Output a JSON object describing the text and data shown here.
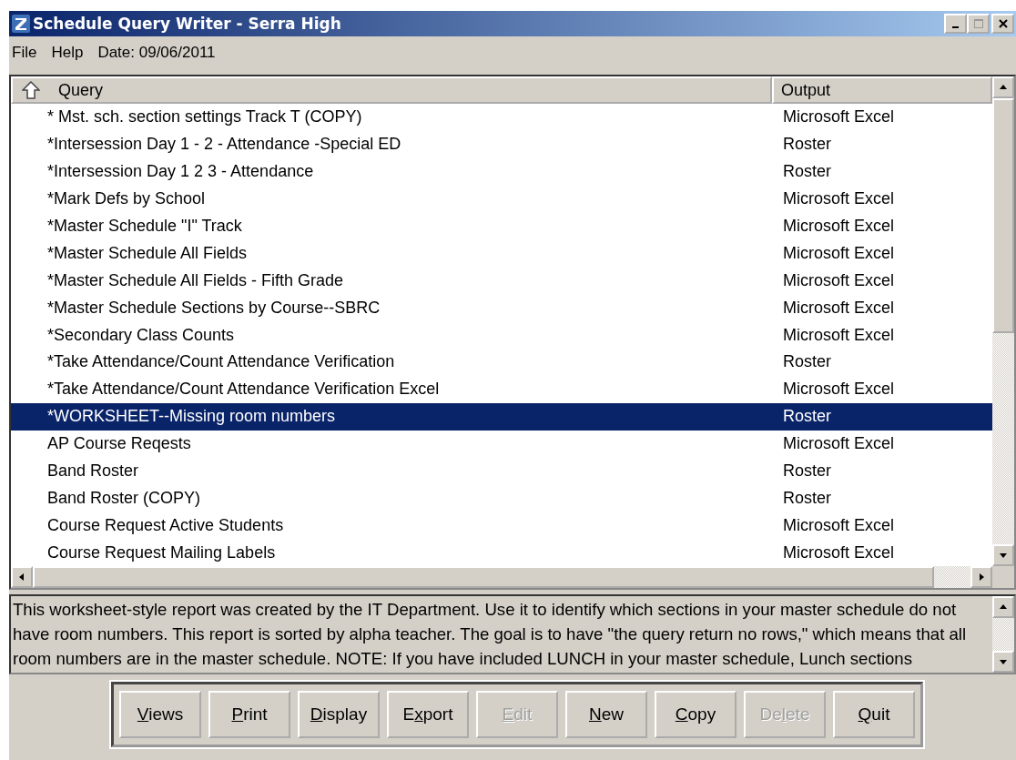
{
  "window": {
    "title": "Schedule Query Writer - Serra High"
  },
  "menu": [
    "File",
    "Help",
    "Date: 09/06/2011"
  ],
  "table": {
    "columns": [
      "Query",
      "Output"
    ],
    "rows": [
      {
        "query": "* Mst. sch. section settings Track T (COPY)",
        "output": "Microsoft Excel",
        "selected": false
      },
      {
        "query": "*Intersession Day 1 - 2 - Attendance -Special ED",
        "output": "Roster",
        "selected": false
      },
      {
        "query": "*Intersession Day 1 2 3 - Attendance",
        "output": "Roster",
        "selected": false
      },
      {
        "query": "*Mark Defs by School",
        "output": "Microsoft Excel",
        "selected": false
      },
      {
        "query": "*Master Schedule \"I\" Track",
        "output": "Microsoft Excel",
        "selected": false
      },
      {
        "query": "*Master Schedule All Fields",
        "output": "Microsoft Excel",
        "selected": false
      },
      {
        "query": "*Master Schedule All Fields - Fifth Grade",
        "output": "Microsoft Excel",
        "selected": false
      },
      {
        "query": "*Master Schedule Sections by Course--SBRC",
        "output": "Microsoft Excel",
        "selected": false
      },
      {
        "query": "*Secondary Class Counts",
        "output": "Microsoft Excel",
        "selected": false
      },
      {
        "query": "*Take Attendance/Count Attendance Verification",
        "output": "Roster",
        "selected": false
      },
      {
        "query": "*Take Attendance/Count Attendance Verification Excel",
        "output": "Microsoft Excel",
        "selected": false
      },
      {
        "query": "*WORKSHEET--Missing room numbers",
        "output": "Roster",
        "selected": true
      },
      {
        "query": "AP Course Reqests",
        "output": "Microsoft Excel",
        "selected": false
      },
      {
        "query": "Band Roster",
        "output": "Roster",
        "selected": false
      },
      {
        "query": "Band Roster (COPY)",
        "output": "Roster",
        "selected": false
      },
      {
        "query": "Course Request Active Students",
        "output": "Microsoft Excel",
        "selected": false
      },
      {
        "query": "Course Request Mailing Labels",
        "output": "Microsoft Excel",
        "selected": false
      }
    ]
  },
  "description": "This worksheet-style report was created by the IT Department. Use it to identify which sections in your master schedule do not have room numbers. This report is sorted by alpha teacher. The goal is to have \"the query return no rows,\" which means that all room numbers are in the master schedule. NOTE: If you have included LUNCH in your master schedule, Lunch sections",
  "buttons": [
    {
      "key": "V",
      "post": "iews",
      "disabled": false
    },
    {
      "key": "P",
      "post": "rint",
      "disabled": false
    },
    {
      "key": "D",
      "post": "isplay",
      "disabled": false
    },
    {
      "pre": "E",
      "key": "x",
      "post": "port",
      "disabled": false
    },
    {
      "key": "E",
      "post": "dit",
      "disabled": true
    },
    {
      "key": "N",
      "post": "ew",
      "disabled": false
    },
    {
      "key": "C",
      "post": "opy",
      "disabled": false
    },
    {
      "pre": "De",
      "key": "l",
      "post": "ete",
      "disabled": true
    },
    {
      "key": "Q",
      "post": "uit",
      "disabled": false
    }
  ]
}
